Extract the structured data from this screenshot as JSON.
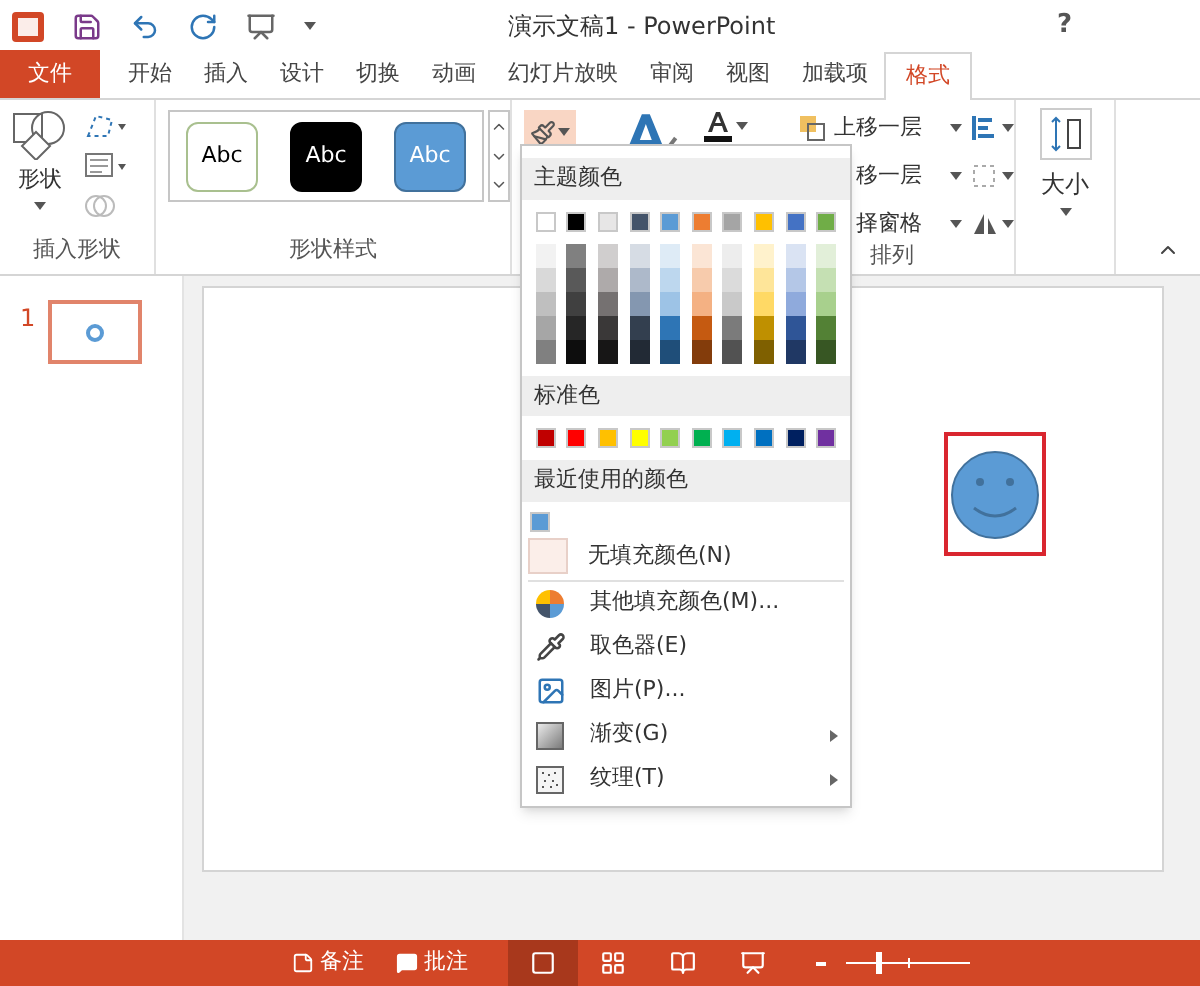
{
  "window": {
    "title": "演示文稿1 - PowerPoint",
    "help": "?"
  },
  "tabs": [
    {
      "label": "文件",
      "kind": "file",
      "selected": false
    },
    {
      "label": "开始",
      "kind": "tab",
      "selected": false
    },
    {
      "label": "插入",
      "kind": "tab",
      "selected": false
    },
    {
      "label": "设计",
      "kind": "tab",
      "selected": false
    },
    {
      "label": "切换",
      "kind": "tab",
      "selected": false
    },
    {
      "label": "动画",
      "kind": "tab",
      "selected": false
    },
    {
      "label": "幻灯片放映",
      "kind": "tab",
      "selected": false
    },
    {
      "label": "审阅",
      "kind": "tab",
      "selected": false
    },
    {
      "label": "视图",
      "kind": "tab",
      "selected": false
    },
    {
      "label": "加载项",
      "kind": "tab",
      "selected": false
    },
    {
      "label": "格式",
      "kind": "tab",
      "selected": true
    }
  ],
  "ribbon": {
    "shapes_button": "形状",
    "insert_group": "插入形状",
    "styles": [
      {
        "label": "Abc",
        "kind": "outline"
      },
      {
        "label": "Abc",
        "kind": "dark"
      },
      {
        "label": "Abc",
        "kind": "blue"
      }
    ],
    "styles_group": "形状样式",
    "arrange": [
      "上移一层",
      "移一层",
      "择窗格"
    ],
    "arrange_group": "排列",
    "size_button": "大小"
  },
  "fill_menu": {
    "theme_heading": "主题颜色",
    "theme_colors": [
      {
        "color": "#ffffff",
        "shades": [
          {
            "color": "#f2f2f2"
          },
          {
            "color": "#d9d9d9"
          },
          {
            "color": "#bfbfbf"
          },
          {
            "color": "#a6a6a6"
          },
          {
            "color": "#808080"
          }
        ]
      },
      {
        "color": "#000000",
        "shades": [
          {
            "color": "#808080"
          },
          {
            "color": "#595959"
          },
          {
            "color": "#404040"
          },
          {
            "color": "#262626"
          },
          {
            "color": "#0d0d0d"
          }
        ]
      },
      {
        "color": "#e7e6e6",
        "shades": [
          {
            "color": "#d0cece"
          },
          {
            "color": "#aeaaaa"
          },
          {
            "color": "#757171"
          },
          {
            "color": "#3a3838"
          },
          {
            "color": "#171616"
          }
        ]
      },
      {
        "color": "#44546a",
        "shades": [
          {
            "color": "#d6dce4"
          },
          {
            "color": "#adb9ca"
          },
          {
            "color": "#8497b0"
          },
          {
            "color": "#333f4f"
          },
          {
            "color": "#222a35"
          }
        ]
      },
      {
        "color": "#5b9bd5",
        "shades": [
          {
            "color": "#deebf6"
          },
          {
            "color": "#bdd7ee"
          },
          {
            "color": "#9dc3e6"
          },
          {
            "color": "#2e75b5"
          },
          {
            "color": "#1f4e79"
          }
        ]
      },
      {
        "color": "#ed7d31",
        "shades": [
          {
            "color": "#fbe5d5"
          },
          {
            "color": "#f7cbac"
          },
          {
            "color": "#f4b183"
          },
          {
            "color": "#c55a11"
          },
          {
            "color": "#833c0b"
          }
        ]
      },
      {
        "color": "#a5a5a5",
        "shades": [
          {
            "color": "#ededed"
          },
          {
            "color": "#dbdbdb"
          },
          {
            "color": "#c9c9c9"
          },
          {
            "color": "#7b7b7b"
          },
          {
            "color": "#525252"
          }
        ]
      },
      {
        "color": "#ffc000",
        "shades": [
          {
            "color": "#fff2cc"
          },
          {
            "color": "#fee599"
          },
          {
            "color": "#ffd965"
          },
          {
            "color": "#bf9000"
          },
          {
            "color": "#7f6000"
          }
        ]
      },
      {
        "color": "#4472c4",
        "shades": [
          {
            "color": "#dae3f3"
          },
          {
            "color": "#b4c7e7"
          },
          {
            "color": "#8faadc"
          },
          {
            "color": "#2f5597"
          },
          {
            "color": "#203864"
          }
        ]
      },
      {
        "color": "#70ad47",
        "shades": [
          {
            "color": "#e2efd9"
          },
          {
            "color": "#c5e0b3"
          },
          {
            "color": "#a8d08d"
          },
          {
            "color": "#538135"
          },
          {
            "color": "#375623"
          }
        ]
      }
    ],
    "standard_heading": "标准色",
    "standard_colors": [
      {
        "color": "#c00000"
      },
      {
        "color": "#ff0000"
      },
      {
        "color": "#ffc000"
      },
      {
        "color": "#ffff00"
      },
      {
        "color": "#92d050"
      },
      {
        "color": "#00b050"
      },
      {
        "color": "#00b0f0"
      },
      {
        "color": "#0070c0"
      },
      {
        "color": "#002060"
      },
      {
        "color": "#7030a0"
      }
    ],
    "recent_heading": "最近使用的颜色",
    "recent_colors": [
      {
        "color": "#5b9bd5"
      }
    ],
    "no_fill": "无填充颜色(N)",
    "items": [
      {
        "label": "其他填充颜色(M)...",
        "kind": "palette",
        "submenu": false
      },
      {
        "label": "取色器(E)",
        "kind": "eyedropper",
        "submenu": false
      },
      {
        "label": "图片(P)...",
        "kind": "picture",
        "submenu": false
      },
      {
        "label": "渐变(G)",
        "kind": "gradient",
        "submenu": true
      },
      {
        "label": "纹理(T)",
        "kind": "texture",
        "submenu": true
      }
    ]
  },
  "slides": [
    {
      "number": "1",
      "selected": true
    }
  ],
  "status_bar": {
    "notes": "备注",
    "comments": "批注",
    "views": [
      {
        "kind": "normal",
        "selected": true
      },
      {
        "kind": "sorter",
        "selected": false
      },
      {
        "kind": "reading",
        "selected": false
      },
      {
        "kind": "slideshow",
        "selected": false
      }
    ],
    "zoom": {
      "level": 0.25
    }
  }
}
